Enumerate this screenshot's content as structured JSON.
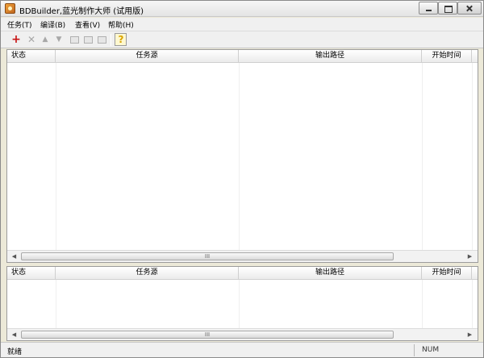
{
  "window": {
    "title": "BDBuilder,蓝光制作大师 (试用版)"
  },
  "menu": {
    "items": [
      "任务(T)",
      "编译(B)",
      "查看(V)",
      "帮助(H)"
    ]
  },
  "toolbar": {
    "add_icon": "plus-icon",
    "help_label": "?"
  },
  "task_list": {
    "columns": [
      "状态",
      "任务源",
      "输出路径",
      "开始时间"
    ],
    "rows": []
  },
  "log_list": {
    "columns": [
      "状态",
      "任务源",
      "输出路径",
      "开始时间"
    ],
    "rows": []
  },
  "scrollbar": {
    "thumb_grip": "III"
  },
  "status": {
    "text": "就绪",
    "indicator": "NUM"
  },
  "colors": {
    "add_icon": "#c81414",
    "window_bg": "#ece9d8"
  }
}
